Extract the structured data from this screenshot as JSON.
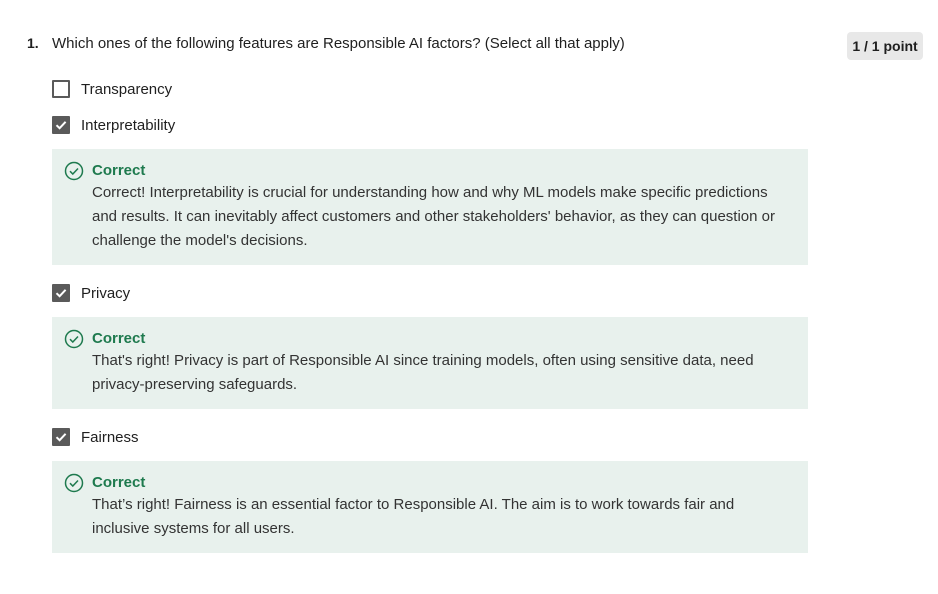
{
  "question": {
    "number": "1.",
    "text": "Which ones of the following features are Responsible AI factors? (Select all that apply)",
    "points": "1 / 1 point"
  },
  "options": [
    {
      "label": "Transparency",
      "checked": false
    },
    {
      "label": "Interpretability",
      "checked": true
    },
    {
      "label": "Privacy",
      "checked": true
    },
    {
      "label": "Fairness",
      "checked": true
    }
  ],
  "feedback": [
    {
      "title": "Correct",
      "text": "Correct! Interpretability is crucial for understanding how and why ML models make specific predictions and results. It can inevitably affect customers and other stakeholders' behavior, as they can question or challenge the model's decisions."
    },
    {
      "title": "Correct",
      "text": "That's right! Privacy is part of Responsible AI since training models, often using sensitive data, need privacy-preserving safeguards."
    },
    {
      "title": "Correct",
      "text": "That’s right! Fairness is an essential factor to Responsible AI. The aim is to work towards fair and inclusive systems for all users."
    }
  ],
  "colors": {
    "correct_green": "#1e7a4e",
    "feedback_bg": "#e8f1ed",
    "checkbox_gray": "#5a5a5a",
    "points_bg": "#e8e8e8"
  },
  "icons": {
    "checkmark": "checkmark-icon",
    "correct": "check-circle-icon"
  }
}
